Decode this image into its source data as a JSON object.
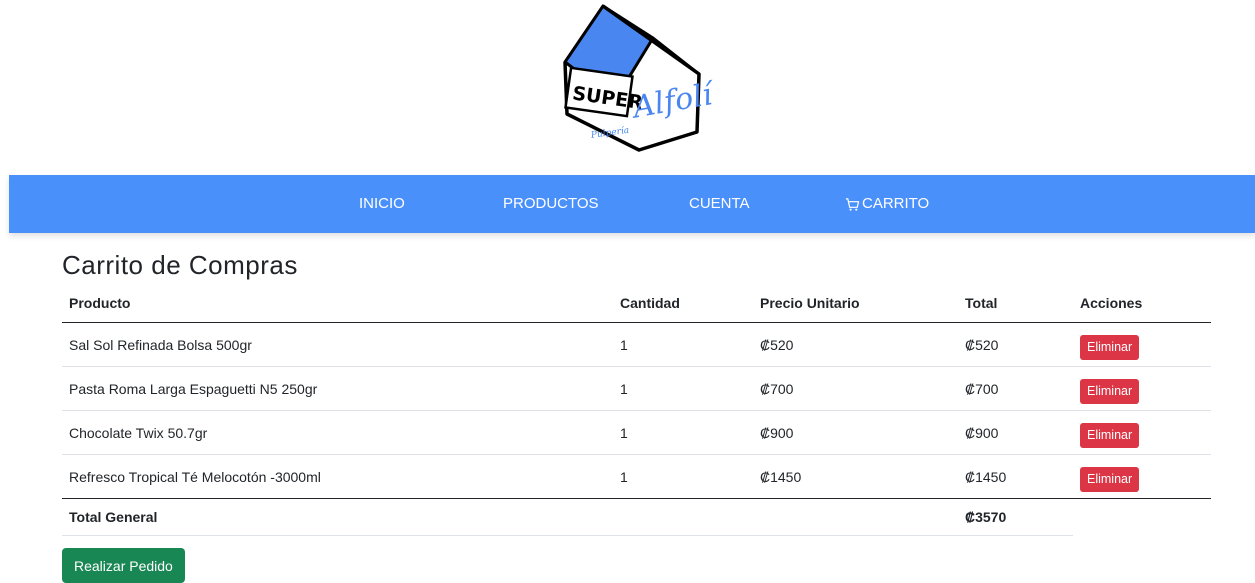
{
  "logo": {
    "word1": "SUPER",
    "word2": "Alfolí",
    "word3": "Pulpería"
  },
  "nav": {
    "items": [
      {
        "label": "INICIO"
      },
      {
        "label": "PRODUCTOS"
      },
      {
        "label": "CUENTA"
      },
      {
        "label": "CARRITO",
        "icon": "cart-icon"
      }
    ]
  },
  "page": {
    "title": "Carrito de Compras"
  },
  "cart": {
    "headers": {
      "producto": "Producto",
      "cantidad": "Cantidad",
      "precio": "Precio Unitario",
      "total": "Total",
      "acciones": "Acciones"
    },
    "rows": [
      {
        "producto": "Sal Sol Refinada Bolsa 500gr",
        "cantidad": "1",
        "precio": "₡520",
        "total": "₡520",
        "action": "Eliminar"
      },
      {
        "producto": "Pasta Roma Larga Espaguetti N5 250gr",
        "cantidad": "1",
        "precio": "₡700",
        "total": "₡700",
        "action": "Eliminar"
      },
      {
        "producto": "Chocolate Twix 50.7gr",
        "cantidad": "1",
        "precio": "₡900",
        "total": "₡900",
        "action": "Eliminar"
      },
      {
        "producto": "Refresco Tropical Té Melocotón -3000ml",
        "cantidad": "1",
        "precio": "₡1450",
        "total": "₡1450",
        "action": "Eliminar"
      }
    ],
    "total_label": "Total General",
    "total_value": "₡3570"
  },
  "actions": {
    "checkout_label": "Realizar Pedido"
  },
  "colors": {
    "navbar": "#4a90fb",
    "danger": "#dc3545",
    "success": "#198754",
    "logo_roof": "#4a86f0"
  }
}
